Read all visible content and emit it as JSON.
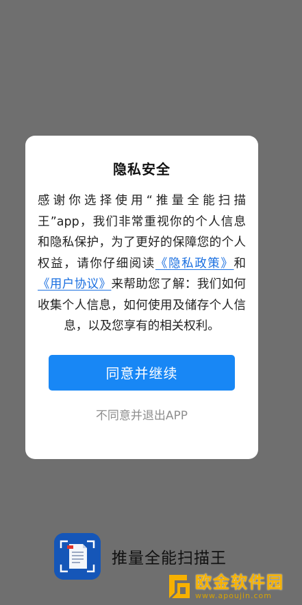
{
  "dialog": {
    "title": "隐私安全",
    "body_lead": "感谢你选择使用“推量全能扫描王”app，我们非常重视你的个人信息和隐私保护，为了更好的保障您的个人权益，请你仔细阅读",
    "privacy_link": "《隐私政策》",
    "and_text": "和",
    "user_agreement_link": "《用户协议》",
    "body_tail": "来帮助您了解：我们如何收集个人信息，如何使用及储存个人信息，以及您享有的相关权利。",
    "agree_button": "同意并继续",
    "decline_label": "不同意并退出APP"
  },
  "app": {
    "name": "推量全能扫描王",
    "logo_icon": "document-scan-icon",
    "brand_color": "#1556b8"
  },
  "watermark": {
    "main": "欧金软件园",
    "url": "www.apoujin.com",
    "color": "#f7b100"
  },
  "colors": {
    "overlay": "#6f6f6f",
    "accent": "#1887f5",
    "link": "#1a6fe0"
  }
}
